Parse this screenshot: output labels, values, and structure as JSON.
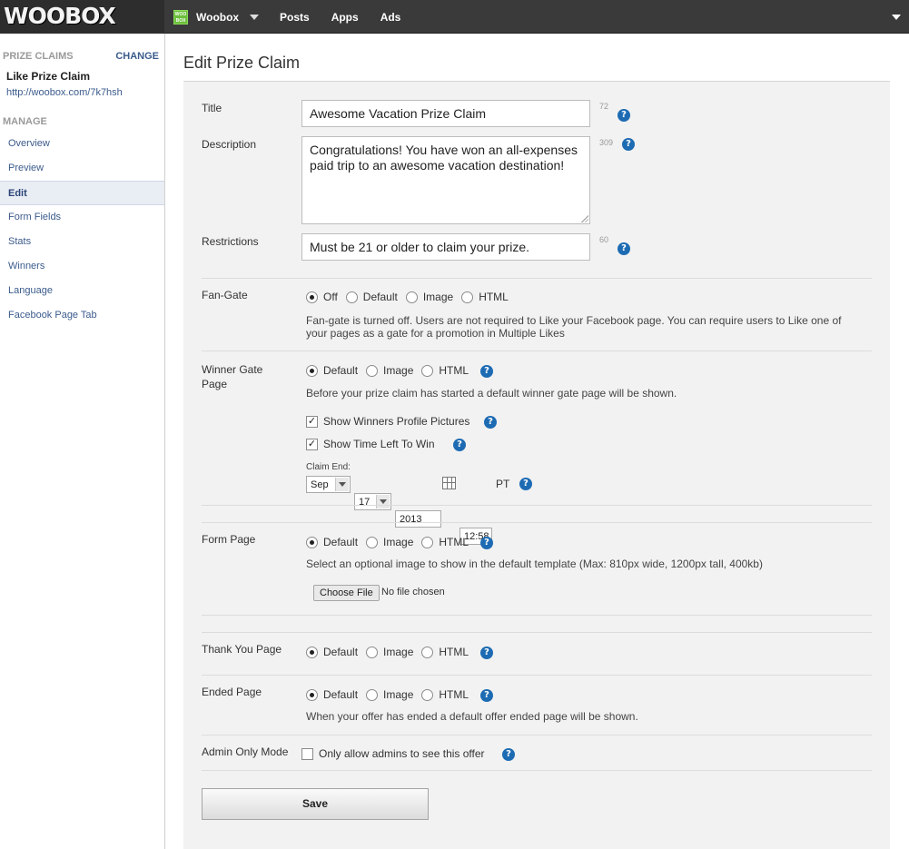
{
  "topbar": {
    "logo_text": "WOOBOX",
    "account_badge": "WOO BOX",
    "account_name": "Woobox",
    "nav": [
      "Posts",
      "Apps",
      "Ads"
    ]
  },
  "sidebar": {
    "section_label": "PRIZE CLAIMS",
    "change_label": "CHANGE",
    "item_title": "Like Prize Claim",
    "item_url": "http://woobox.com/7k7hsh",
    "manage_label": "MANAGE",
    "items": [
      {
        "label": "Overview",
        "active": false
      },
      {
        "label": "Preview",
        "active": false
      },
      {
        "label": "Edit",
        "active": true
      },
      {
        "label": "Form Fields",
        "active": false
      },
      {
        "label": "Stats",
        "active": false
      },
      {
        "label": "Winners",
        "active": false
      },
      {
        "label": "Language",
        "active": false
      },
      {
        "label": "Facebook Page Tab",
        "active": false
      }
    ]
  },
  "page_title": "Edit Prize Claim",
  "help_glyph": "?",
  "form": {
    "title": {
      "label": "Title",
      "value": "Awesome Vacation Prize Claim",
      "count": "72"
    },
    "description": {
      "label": "Description",
      "value": "Congratulations! You have won an all-expenses paid trip to an awesome vacation destination!",
      "count": "309"
    },
    "restrictions": {
      "label": "Restrictions",
      "value": "Must be 21 or older to claim your prize.",
      "count": "60"
    },
    "fan_gate": {
      "label": "Fan-Gate",
      "options": [
        "Off",
        "Default",
        "Image",
        "HTML"
      ],
      "selected": "Off",
      "note": "Fan-gate is turned off. Users are not required to Like your Facebook page. You can require users to Like one of your pages as a gate for a promotion in Multiple Likes"
    },
    "winner_gate": {
      "label": "Winner Gate Page",
      "options": [
        "Default",
        "Image",
        "HTML"
      ],
      "selected": "Default",
      "note": "Before your prize claim has started a default winner gate page will be shown.",
      "show_profile_pictures": {
        "label": "Show Winners Profile Pictures",
        "checked": true
      },
      "show_time_left": {
        "label": "Show Time Left To Win",
        "checked": true
      },
      "claim_end_label": "Claim End:",
      "month": "Sep",
      "day": "17",
      "year": "2013",
      "time": "12:58",
      "tz": "PT"
    },
    "form_page": {
      "label": "Form Page",
      "options": [
        "Default",
        "Image",
        "HTML"
      ],
      "selected": "Default",
      "note": "Select an optional image to show in the default template (Max: 810px wide, 1200px tall, 400kb)",
      "choose_file_label": "Choose File",
      "no_file_text": "No file chosen"
    },
    "thank_you_page": {
      "label": "Thank You Page",
      "options": [
        "Default",
        "Image",
        "HTML"
      ],
      "selected": "Default"
    },
    "ended_page": {
      "label": "Ended Page",
      "options": [
        "Default",
        "Image",
        "HTML"
      ],
      "selected": "Default",
      "note": "When your offer has ended a default offer ended page will be shown."
    },
    "admin_only": {
      "label": "Admin Only Mode",
      "checkbox_label": "Only allow admins to see this offer",
      "checked": false
    },
    "save_label": "Save"
  },
  "colors": {
    "topbar": "#3a3a3a",
    "link": "#3b5b8c",
    "help_icon": "#1d6bb3",
    "panel": "#f2f2f2"
  }
}
